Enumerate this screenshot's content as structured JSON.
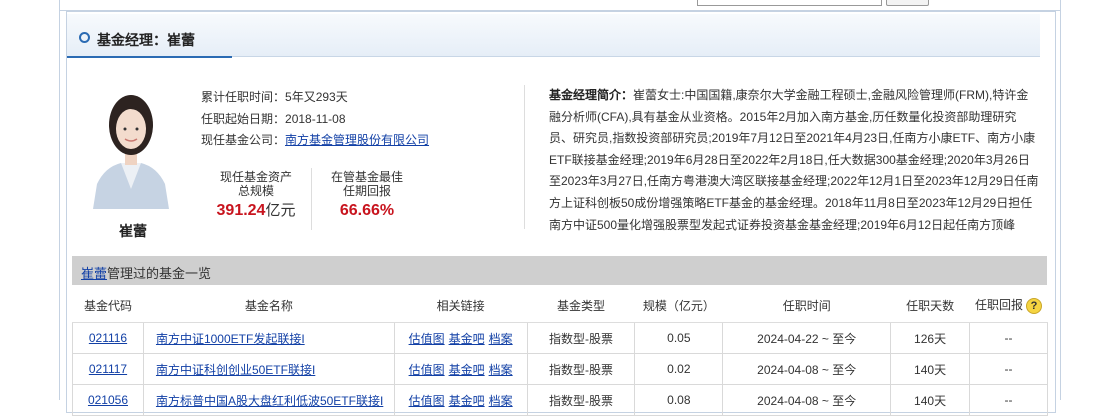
{
  "header": {
    "title": "基金经理：崔蕾"
  },
  "manager": {
    "name": "崔蕾",
    "tenure_label": "累计任职时间：",
    "tenure_value": "5年又293天",
    "start_label": "任职起始日期：",
    "start_value": "2018-11-08",
    "company_label": "现任基金公司：",
    "company_value": "南方基金管理股份有限公司"
  },
  "stats": {
    "assets_label_1": "现任基金资产",
    "assets_label_2": "总规模",
    "assets_value": "391.24",
    "assets_unit": "亿元",
    "return_label_1": "在管基金最佳",
    "return_label_2": "任期回报",
    "return_value": "66.66%"
  },
  "bio": {
    "label": "基金经理简介：",
    "text": "崔蕾女士:中国国籍,康奈尔大学金融工程硕士,金融风险管理师(FRM),特许金融分析师(CFA),具有基金从业资格。2015年2月加入南方基金,历任数量化投资部助理研究员、研究员,指数投资部研究员;2019年7月12日至2021年4月23日,任南方小康ETF、南方小康ETF联接基金经理;2019年6月28日至2022年2月18日,任大数据300基金经理;2020年3月26日至2023年3月27日,任南方粤港澳大湾区联接基金经理;2022年12月1日至2023年12月29日任南方上证科创板50成份增强策略ETF基金的基金经理。2018年11月8日至2023年12月29日担任南方中证500量化增强股票型发起式证券投资基金基金经理;2019年6月12日起任南方顶峰"
  },
  "fund_list": {
    "title_link": "崔蕾",
    "title_rest": "管理过的基金一览",
    "headers": [
      "基金代码",
      "基金名称",
      "相关链接",
      "基金类型",
      "规模（亿元）",
      "任职时间",
      "任职天数",
      "任职回报"
    ],
    "help_glyph": "?",
    "link_labels": [
      "估值图",
      "基金吧",
      "档案"
    ],
    "rows": [
      {
        "code": "021116",
        "name": "南方中证1000ETF发起联接I",
        "type": "指数型-股票",
        "scale": "0.05",
        "period": "2024-04-22 ~ 至今",
        "days": "126天",
        "ret": "--"
      },
      {
        "code": "021117",
        "name": "南方中证科创创业50ETF联接I",
        "type": "指数型-股票",
        "scale": "0.02",
        "period": "2024-04-08 ~ 至今",
        "days": "140天",
        "ret": "--"
      },
      {
        "code": "021056",
        "name": "南方标普中国A股大盘红利低波50ETF联接I",
        "type": "指数型-股票",
        "scale": "0.08",
        "period": "2024-04-08 ~ 至今",
        "days": "140天",
        "ret": "--"
      }
    ]
  }
}
